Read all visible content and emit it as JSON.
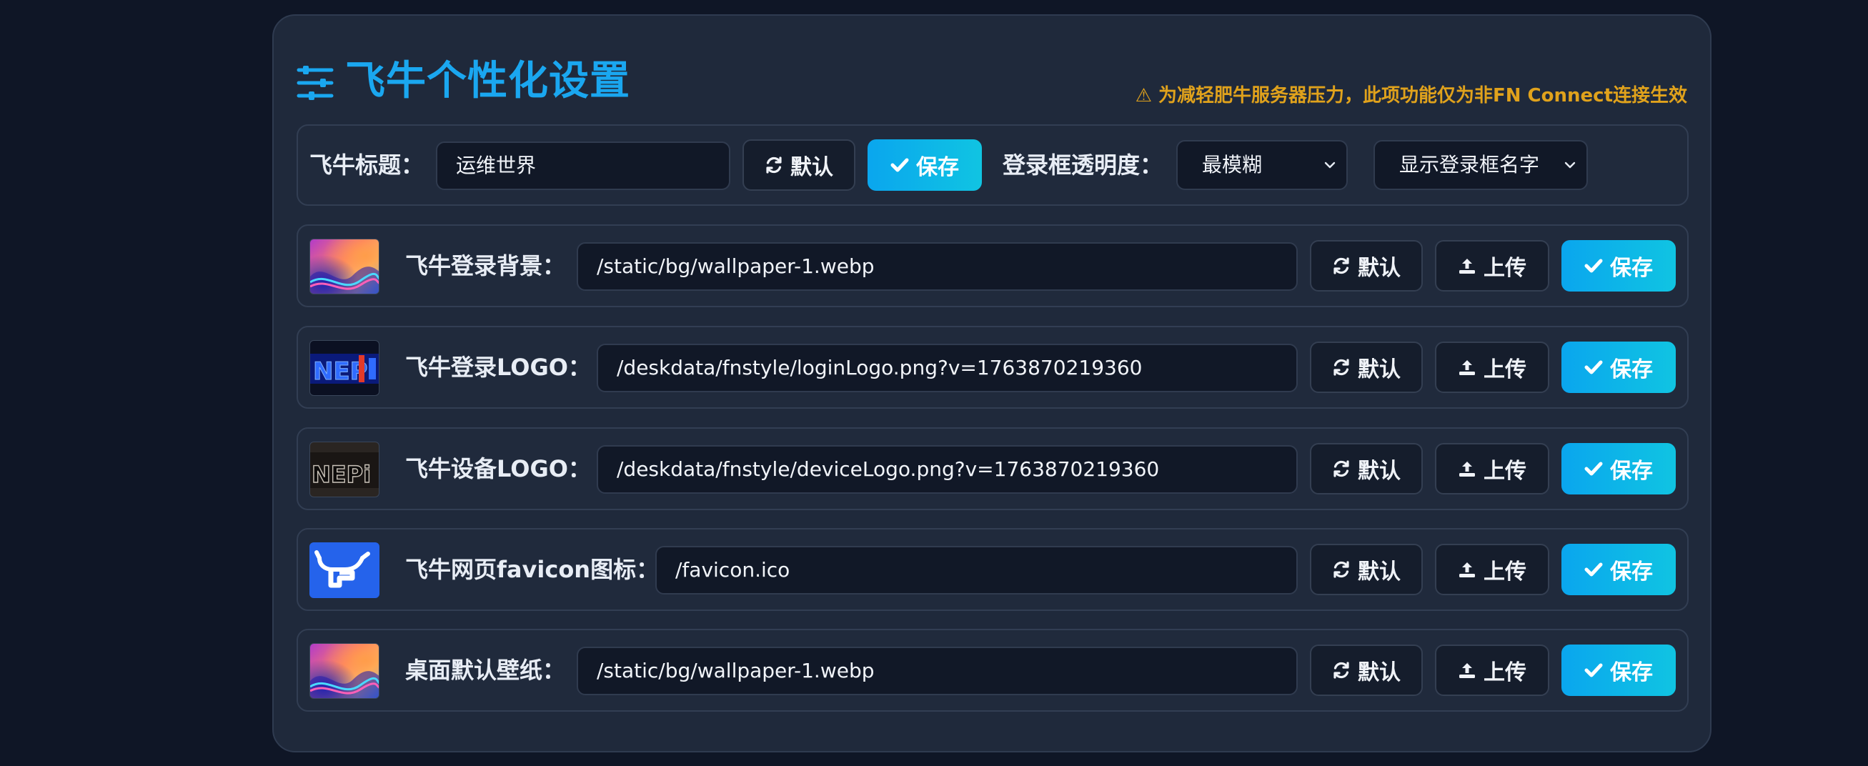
{
  "header": {
    "title": "飞牛个性化设置",
    "notice": "⚠ 为减轻肥牛服务器压力，此项功能仅为非FN Connect连接生效"
  },
  "title_row": {
    "label": "飞牛标题：",
    "value": "运维世界",
    "default_label": "默认",
    "save_label": "保存",
    "opacity_label": "登录框透明度：",
    "opacity_value": "最模糊",
    "name_display_value": "显示登录框名字"
  },
  "items": [
    {
      "label": "飞牛登录背景：",
      "value": "/static/bg/wallpaper-1.webp",
      "default_label": "默认",
      "upload_label": "上传",
      "save_label": "保存"
    },
    {
      "label": "飞牛登录LOGO：",
      "value": "/deskdata/fnstyle/loginLogo.png?v=1763870219360",
      "default_label": "默认",
      "upload_label": "上传",
      "save_label": "保存"
    },
    {
      "label": "飞牛设备LOGO：",
      "value": "/deskdata/fnstyle/deviceLogo.png?v=1763870219360",
      "default_label": "默认",
      "upload_label": "上传",
      "save_label": "保存"
    },
    {
      "label": "飞牛网页favicon图标：",
      "value": "/favicon.ico",
      "default_label": "默认",
      "upload_label": "上传",
      "save_label": "保存"
    },
    {
      "label": "桌面默认壁纸：",
      "value": "/static/bg/wallpaper-1.webp",
      "default_label": "默认",
      "upload_label": "上传",
      "save_label": "保存"
    }
  ],
  "icons": {
    "header": "sliders-icon",
    "default": "refresh-icon",
    "upload": "upload-icon",
    "save": "check-icon",
    "select": "chevron-down-icon"
  },
  "colors": {
    "accent": "#1aa7f0",
    "warning": "#e0a21c",
    "save": "#0aa6ee",
    "favicon": "#2563eb"
  }
}
